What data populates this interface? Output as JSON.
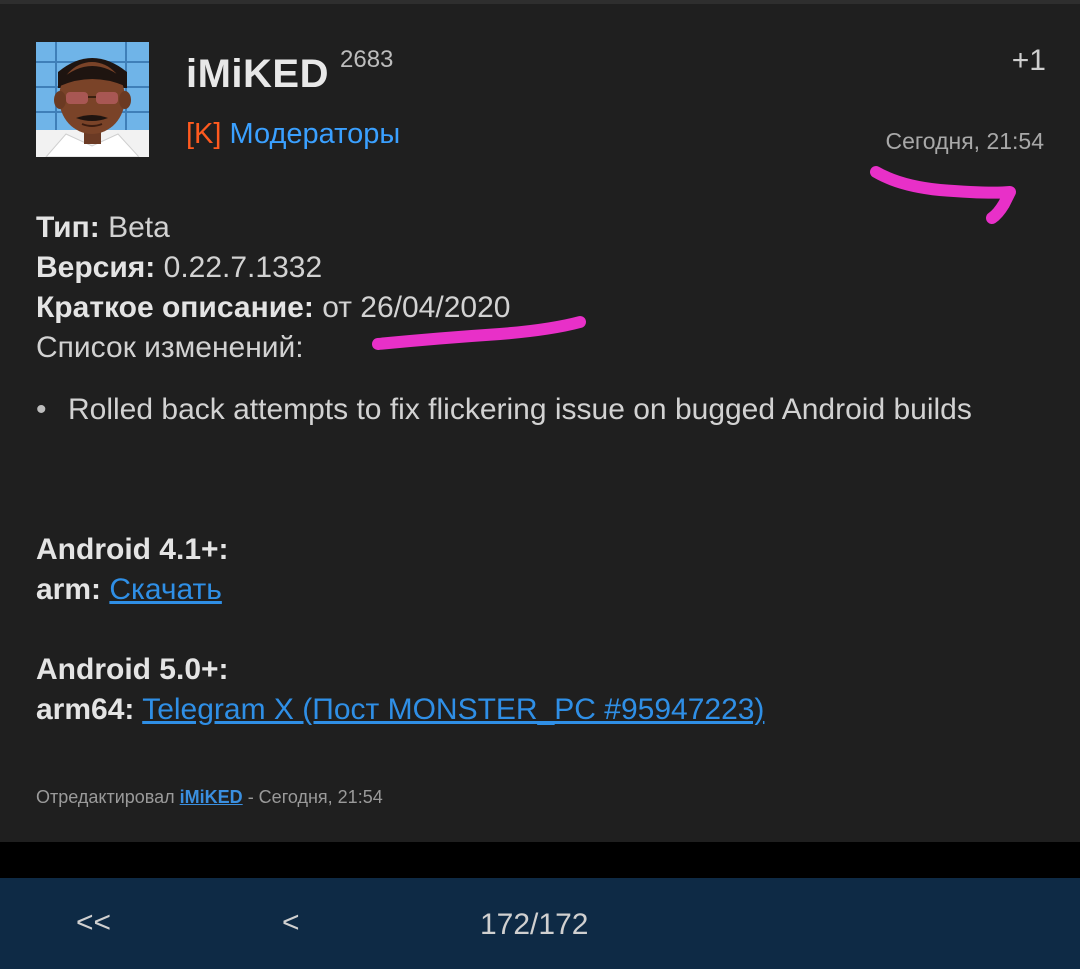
{
  "post": {
    "username": "iMiKED",
    "reputation": "2683",
    "plus_one": "+1",
    "group_tag": "[K]",
    "group_name": "Модераторы",
    "date": "Сегодня, 21:54",
    "type_label": "Тип:",
    "type_value": "Beta",
    "version_label": "Версия:",
    "version_value": "0.22.7.1332",
    "summary_label": "Краткое описание:",
    "summary_value": "от 26/04/2020",
    "changelog_label": "Список изменений:",
    "changes": [
      "Rolled back attempts to fix flickering issue on bugged Android builds"
    ],
    "bullet": "•",
    "android41_label": "Android 4.1+:",
    "arm_label": "arm:",
    "arm_link": "Скачать",
    "android50_label": "Android 5.0+:",
    "arm64_label": "arm64:",
    "arm64_link": "Telegram X (Пост MONSTER_PC #95947223)",
    "edited_prefix": "Отредактировал",
    "edited_by": "iMiKED",
    "edited_suffix": "- Сегодня, 21:54"
  },
  "nav": {
    "first": "<<",
    "prev": "<",
    "page_counter": "172/172"
  },
  "colors": {
    "card_bg": "#1f1f1f",
    "link": "#2f8fe6",
    "group_tag": "#ff5a1f",
    "highlight": "#e830c8",
    "bottom_bar": "#0e2a45"
  }
}
